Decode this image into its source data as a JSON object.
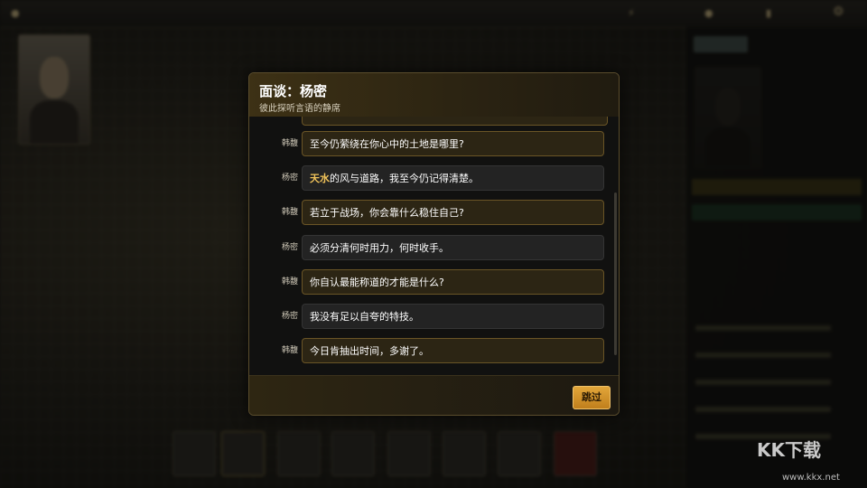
{
  "dialog": {
    "title": "面谈：杨密",
    "subtitle": "彼此探听言语的静席",
    "skip_label": "跳过",
    "messages": [
      {
        "speaker": "韩馥",
        "text": "至今仍萦绕在你心中的土地是哪里?",
        "style": "question"
      },
      {
        "speaker": "杨密",
        "highlight": "天水",
        "text": "的风与道路，我至今仍记得清楚。",
        "style": "answer"
      },
      {
        "speaker": "韩馥",
        "text": "若立于战场，你会靠什么稳住自己?",
        "style": "question"
      },
      {
        "speaker": "杨密",
        "text": "必须分清何时用力，何时收手。",
        "style": "answer"
      },
      {
        "speaker": "韩馥",
        "text": "你自认最能称道的才能是什么?",
        "style": "question"
      },
      {
        "speaker": "杨密",
        "text": "我没有足以自夸的特技。",
        "style": "answer"
      },
      {
        "speaker": "韩馥",
        "text": "今日肯抽出时间，多谢了。",
        "style": "question"
      }
    ]
  },
  "watermark": {
    "logo_text": "KK下载",
    "url": "www.kkx.net"
  },
  "colors": {
    "accent": "#e2a63a",
    "highlight": "#f2c45a",
    "question_bubble": "#2c2514",
    "answer_bubble": "#232323"
  }
}
